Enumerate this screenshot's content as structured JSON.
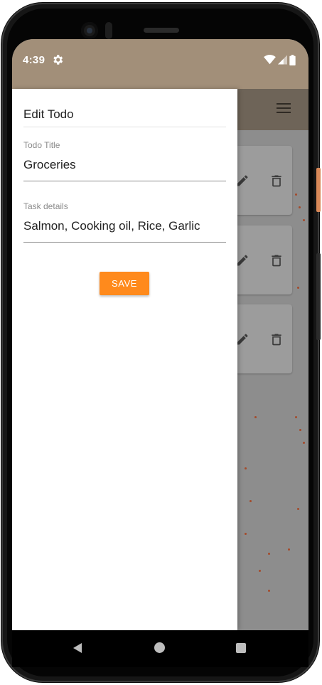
{
  "status_bar": {
    "time": "4:39",
    "background_color": "#a28f79",
    "icons": [
      "gear-icon",
      "wifi-icon",
      "cell-signal-icon",
      "battery-icon"
    ]
  },
  "background_app": {
    "appbar_icon": "menu-icon",
    "cards": [
      {
        "icons": [
          "edit-icon",
          "delete-icon"
        ]
      },
      {
        "icons": [
          "edit-icon",
          "delete-icon"
        ]
      },
      {
        "icons": [
          "edit-icon",
          "delete-icon"
        ]
      }
    ]
  },
  "drawer": {
    "title": "Edit Todo",
    "todo_title": {
      "label": "Todo Title",
      "value": "Groceries"
    },
    "task_details": {
      "label": "Task details",
      "value": "Salmon, Cooking oil, Rice, Garlic"
    },
    "save_label": "SAVE",
    "accent_color": "#ff8a1c"
  },
  "nav_bar": {
    "icons": [
      "back-icon",
      "home-icon",
      "recents-icon"
    ]
  }
}
